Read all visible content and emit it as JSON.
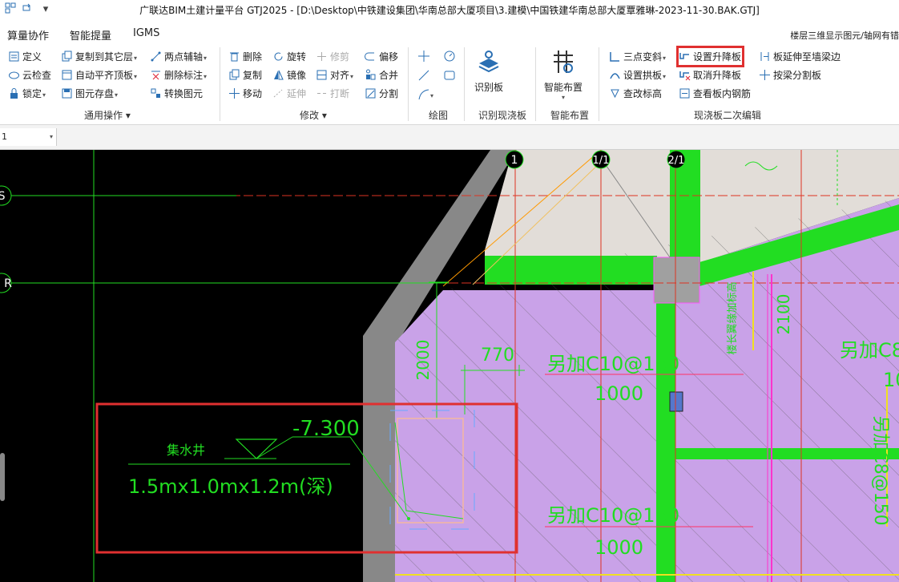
{
  "window": {
    "title": "广联达BIM土建计量平台 GTJ2025 - [D:\\Desktop\\中铁建设集团\\华南总部大厦项目\\3.建模\\中国铁建华南总部大厦覃雅琳-2023-11-30.BAK.GTJ]",
    "qa_dropdown": "▾"
  },
  "menu": {
    "items": [
      "算量协作",
      "智能提量",
      "IGMS"
    ],
    "right_text": "楼层三维显示图元/轴网有错"
  },
  "ribbon": {
    "general": {
      "label": "通用操作",
      "col1": [
        "定义",
        "云检查",
        "锁定"
      ],
      "col2": [
        "复制到其它层",
        "自动平齐顶板",
        "图元存盘"
      ],
      "col3": [
        "两点辅轴",
        "删除标注",
        "转换图元"
      ]
    },
    "modify": {
      "label": "修改",
      "col1": [
        "删除",
        "复制",
        "移动"
      ],
      "col2": [
        "旋转",
        "镜像",
        "延伸"
      ],
      "col3": [
        "修剪",
        "对齐",
        "打断"
      ],
      "col4": [
        "偏移",
        "合并",
        "分割"
      ]
    },
    "draw": {
      "label": "绘图"
    },
    "identify": {
      "button": "识别板",
      "label": "识别现浇板"
    },
    "smart": {
      "button": "智能布置",
      "label": "智能布置"
    },
    "edit2": {
      "label": "现浇板二次编辑",
      "col1": [
        "三点变斜",
        "设置拱板",
        "查改标高"
      ],
      "col2": [
        "设置升降板",
        "取消升降板",
        "查看板内钢筋"
      ],
      "col3": [
        "板延伸至墙梁边",
        "按梁分割板"
      ]
    }
  },
  "toolbar": {
    "floor_value": "1"
  },
  "drawing": {
    "axes": [
      "1",
      "1/1",
      "2/1",
      "S",
      "R"
    ],
    "dims": [
      "2000",
      "770",
      "2100"
    ],
    "elevation": "-7.300",
    "pit_label": "集水井",
    "pit_size": "1.5mx1.0mx1.2m(深)",
    "rebar_top": "另加C10@150",
    "rebar_top_len": "1000",
    "rebar_bot": "另加C10@150",
    "rebar_bot_len": "1000",
    "rebar_right": "另加C8@1",
    "rebar_right_len": "10",
    "rebar_right_vert": "另加C8@150",
    "vertical_note": "楼长翼缘加标高"
  },
  "colors": {
    "highlight": "#e03030",
    "slab": "#c9a2e8",
    "beam": "#22dd22",
    "wall": "#888888",
    "canvas": "#000000"
  }
}
